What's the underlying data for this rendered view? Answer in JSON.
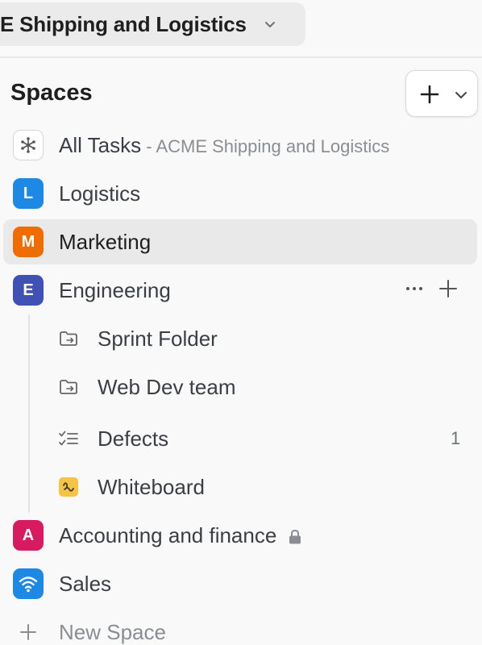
{
  "workspace": {
    "name": "E Shipping and Logistics",
    "chevron_icon": "chevron-down-icon"
  },
  "sidebar": {
    "title": "Spaces",
    "add_button": {
      "icon": "plus-icon",
      "menu_icon": "chevron-down-icon"
    },
    "all_tasks": {
      "label": "All Tasks",
      "suffix": " - ACME Shipping and Logistics",
      "icon": "hub-icon"
    },
    "spaces": [
      {
        "initial": "L",
        "label": "Logistics",
        "color": "#1e88e5"
      },
      {
        "initial": "M",
        "label": "Marketing",
        "color": "#ef6c00",
        "selected": true
      },
      {
        "initial": "E",
        "label": "Engineering",
        "color": "#3f51b5",
        "actions": {
          "more": "more-icon",
          "add": "plus-icon"
        },
        "children": [
          {
            "label": "Sprint Folder",
            "icon": "folder-sync-icon"
          },
          {
            "label": "Web Dev team",
            "icon": "folder-sync-icon"
          },
          {
            "label": "Defects",
            "icon": "checklist-icon",
            "count": "1"
          },
          {
            "label": "Whiteboard",
            "icon": "whiteboard-icon",
            "color": "#f6c343"
          }
        ]
      },
      {
        "initial": "A",
        "label": "Accounting and finance",
        "color": "#d81b60",
        "private": true
      },
      {
        "initial": "",
        "label": "Sales",
        "color": "#1e88e5",
        "icon": "wifi-icon"
      }
    ],
    "new_space": {
      "label": "New Space",
      "icon": "plus-icon"
    }
  }
}
